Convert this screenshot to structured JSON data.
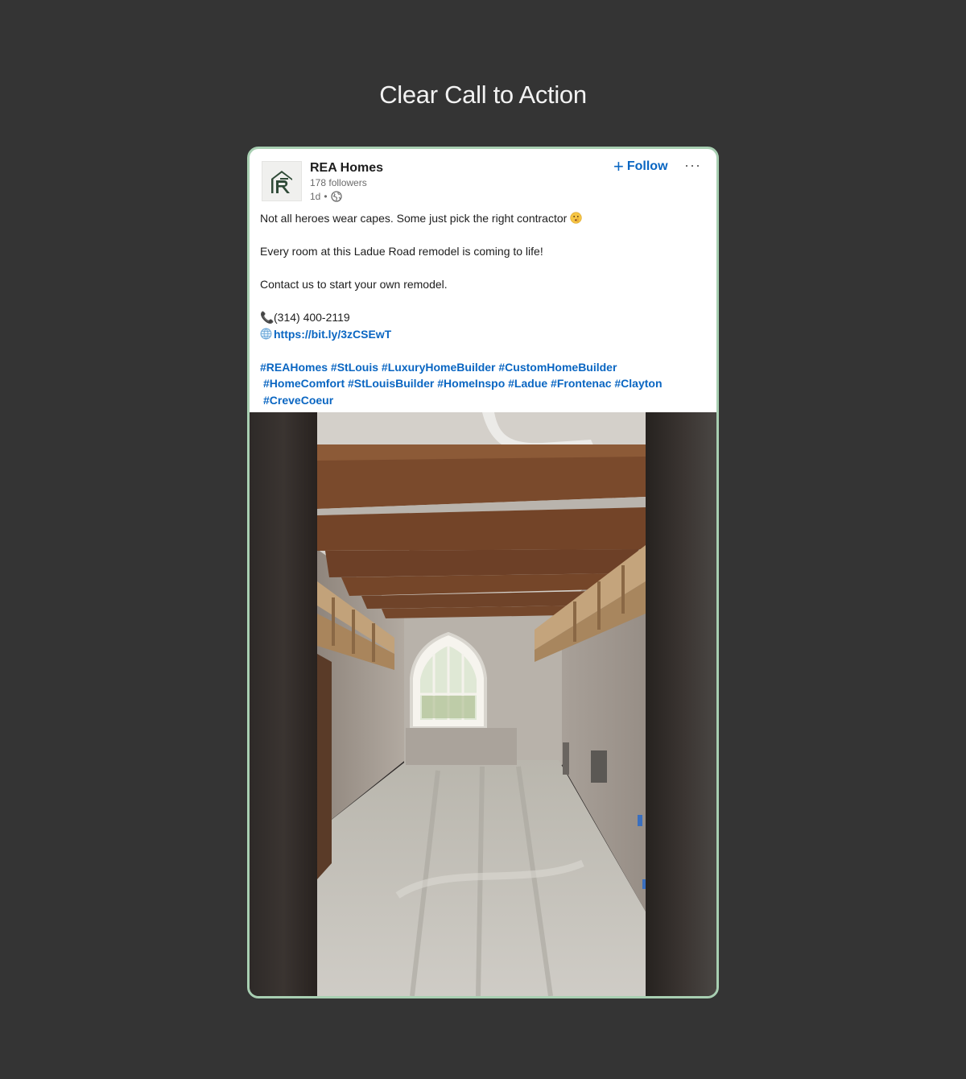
{
  "page": {
    "heading": "Clear Call to Action"
  },
  "post": {
    "company_name": "REA Homes",
    "followers": "178 followers",
    "age": "1d",
    "visibility_icon": "globe-icon",
    "follow_label": "Follow",
    "more_label": "···",
    "text": {
      "line1": "Not all heroes wear capes. Some just pick the right contractor",
      "line1_emoji": "shushing-face-emoji",
      "line2": "Every room at this Ladue Road remodel is coming to life!",
      "line3": "Contact us to start your own remodel.",
      "phone": "(314) 400-2119",
      "phone_icon": "telephone-icon",
      "link": "https://bit.ly/3zCSEwT",
      "link_icon": "globe-icon"
    },
    "hashtags": {
      "row1": "#REAHomes #StLouis #LuxuryHomeBuilder #CustomHomeBuilder",
      "row2": "#HomeComfort #StLouisBuilder #HomeInspo #Ladue #Frontenac #Clayton",
      "row3": "#CreveCoeur"
    },
    "media": {
      "type": "video-still",
      "subject": "interior remodel with exposed wooden ceiling beams and gothic arched window"
    }
  },
  "colors": {
    "background": "#343434",
    "card_border": "#a8cfb2",
    "link_blue": "#0a66c2",
    "logo_green": "#2f4a37"
  }
}
